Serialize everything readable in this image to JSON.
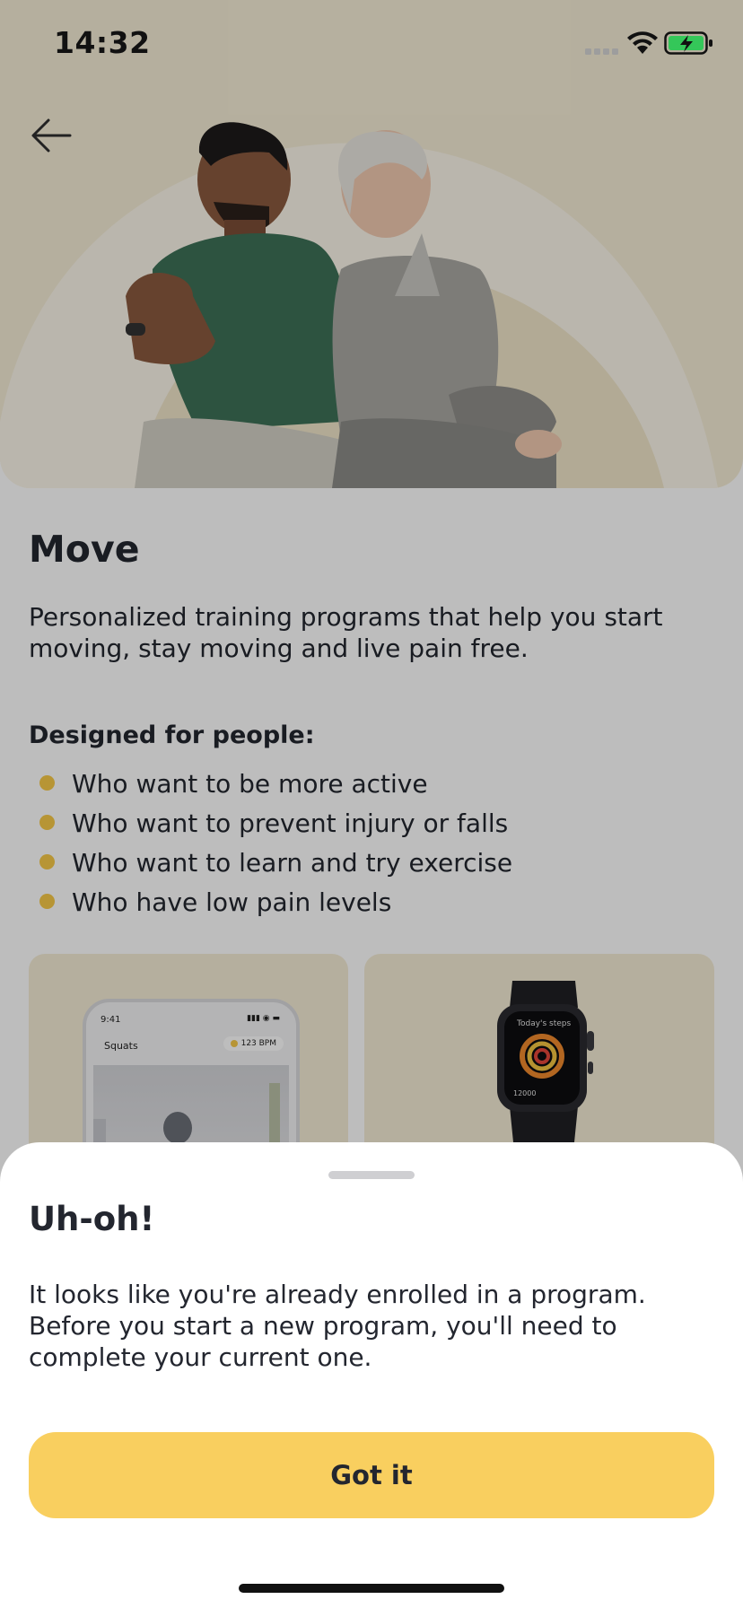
{
  "status_bar": {
    "time": "14:32"
  },
  "program": {
    "title": "Move",
    "description": "Personalized training programs that help you start moving, stay moving and live pain free.",
    "designed_for_heading": "Designed for people:",
    "audience": [
      "Who want to be more active",
      "Who want to prevent injury or falls",
      "Who want to learn and try exercise",
      "Who have low pain levels"
    ]
  },
  "app_preview": {
    "time": "9:41",
    "screen_title": "Squats",
    "heart_rate": "123 BPM"
  },
  "watch_preview": {
    "screen_title": "Today's steps",
    "steps": "12000"
  },
  "sheet": {
    "title": "Uh-oh!",
    "message": "It looks like you're already enrolled in a program. Before you start a new program, you'll need to complete your current one.",
    "button_label": "Got it"
  },
  "colors": {
    "accent": "#f9cf5f",
    "bullet": "#f7c948",
    "hero_background": "#f5edd6",
    "text": "#23262f",
    "overlay": "rgba(0,0,0,0.26)"
  },
  "icons": {
    "back": "arrow-left-icon",
    "wifi": "wifi-icon",
    "battery": "battery-charging-icon",
    "signal": "cellular-signal-icon"
  }
}
